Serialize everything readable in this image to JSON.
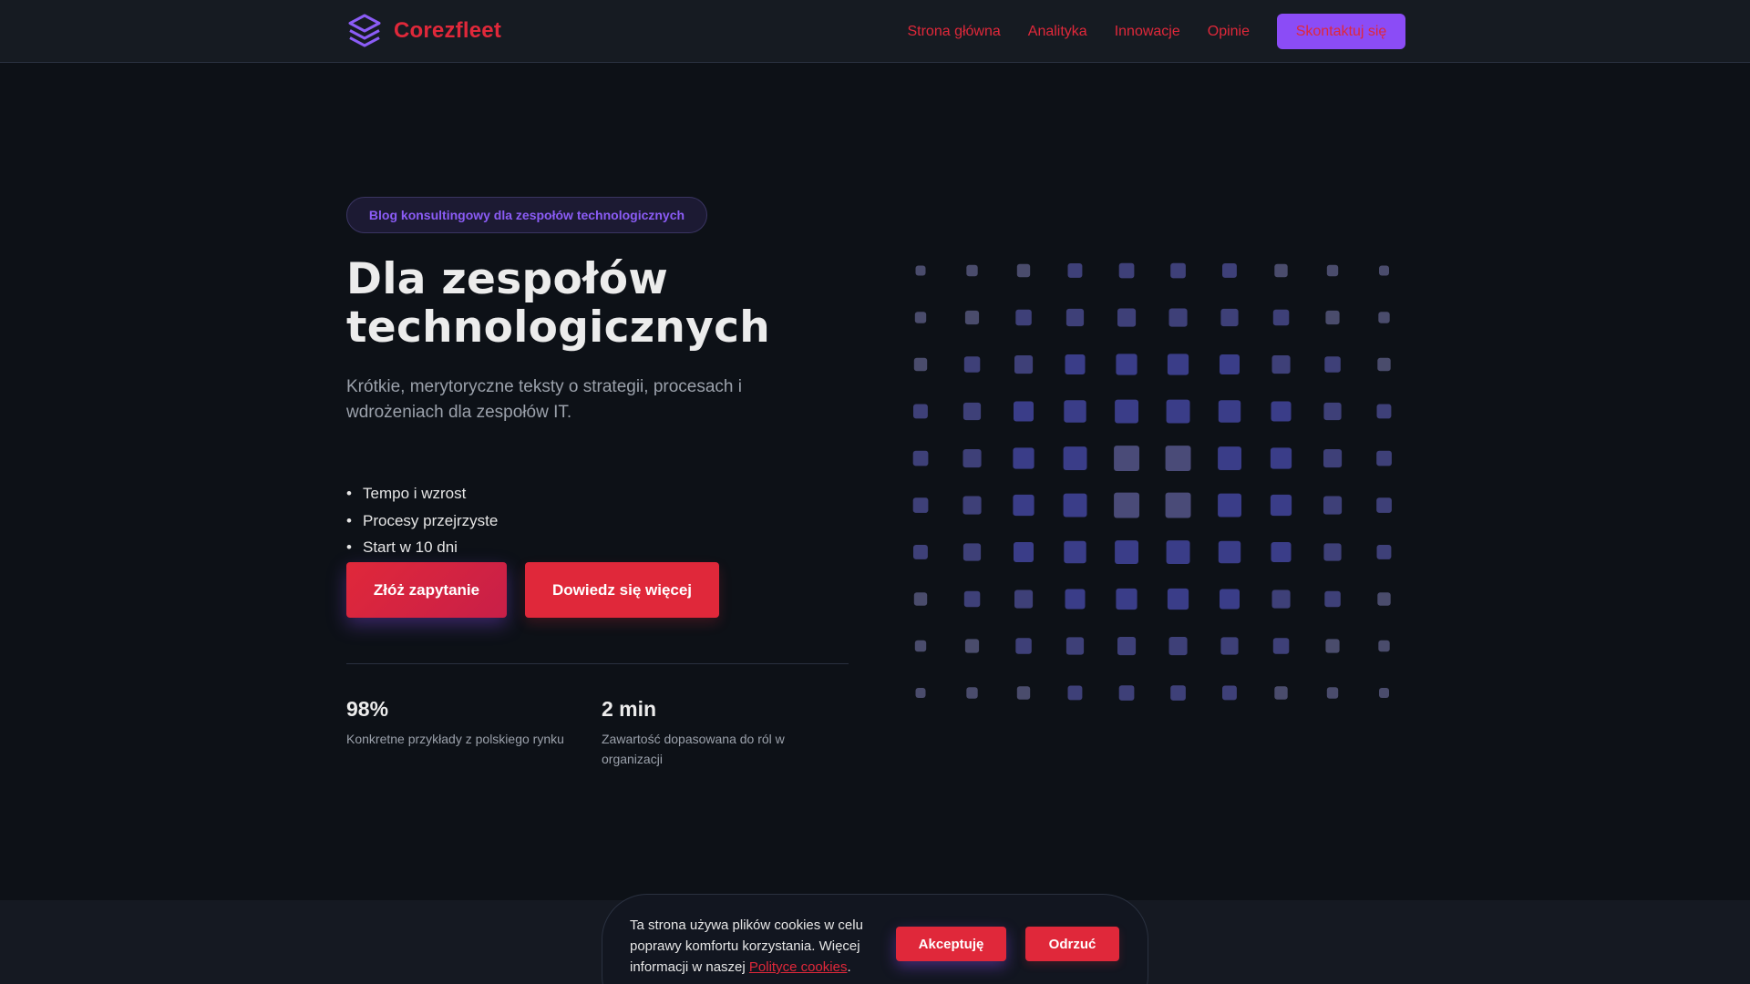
{
  "brand": {
    "name": "Corezfleet",
    "logo_icon": "layers-icon",
    "accent": "#e0283a",
    "purple": "#8b4cf6"
  },
  "nav": {
    "items": [
      "Strona główna",
      "Analityka",
      "Innowacje",
      "Opinie"
    ],
    "cta": "Skontaktuj się"
  },
  "hero": {
    "badge": "Blog konsultingowy dla zespołów technologicznych",
    "title": "Dla zespołów technologicznych",
    "subtitle": "Krótkie, merytoryczne teksty o strategii, procesach i wdrożeniach dla zespołów IT.",
    "features": [
      "Tempo i wzrost",
      "Procesy przejrzyste",
      "Start w 10 dni"
    ],
    "primary_button": "Złóż zapytanie",
    "secondary_button": "Dowiedz się więcej",
    "stats": [
      {
        "value": "98%",
        "label": "Konkretne przykłady z polskiego rynku"
      },
      {
        "value": "2 min",
        "label": "Zawartość dopasowana do ról w organizacji"
      }
    ]
  },
  "cookie": {
    "text_before": "Ta strona używa plików cookies w celu poprawy komfortu korzystania. Więcej informacji w naszej ",
    "link": "Polityce cookies",
    "text_after": ".",
    "accept": "Akceptuję",
    "reject": "Odrzuć"
  }
}
